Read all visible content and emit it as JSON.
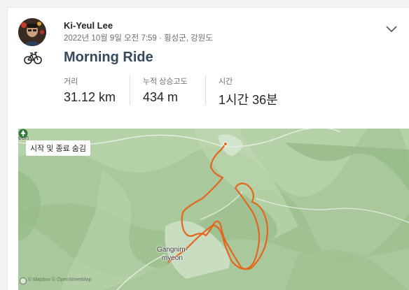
{
  "athlete": {
    "name": "Ki-Yeul Lee",
    "meta": "2022년 10월 9일 오전 7:59 · 횡성군, 강원도"
  },
  "activity": {
    "type_icon": "bike-icon",
    "title": "Morning Ride"
  },
  "stats": [
    {
      "label": "거리",
      "value": "31.12 km"
    },
    {
      "label": "누적 상승고도",
      "value": "434 m"
    },
    {
      "label": "시간",
      "value": "1시간 36분"
    }
  ],
  "map": {
    "toggle_label": "시작 및 종료 숨김",
    "edge_label": "eon",
    "town_label_line1": "Gangnim-",
    "town_label_line2": "myeon",
    "attribution": "© Mapbox © OpenStreetMap",
    "route_color": "#e5661e",
    "base_color": "#a7c89a",
    "road_color": "#dfe9d9"
  },
  "colors": {
    "title": "#36495a",
    "text": "#242428",
    "muted": "#6d6d78"
  }
}
